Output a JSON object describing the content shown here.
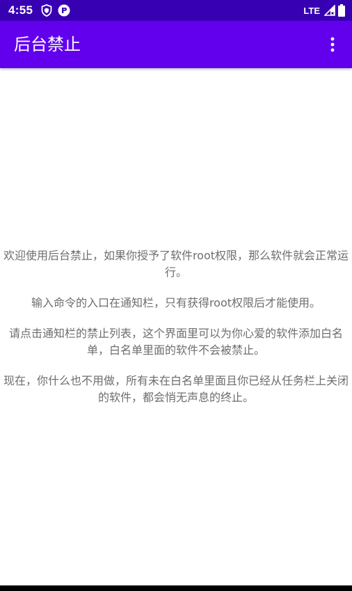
{
  "status_bar": {
    "time": "4:55",
    "network": "LTE",
    "icons_left": [
      "shield-icon",
      "app-notification-icon"
    ],
    "icons_right": [
      "signal-icon",
      "battery-icon"
    ]
  },
  "app_bar": {
    "title": "后台禁止",
    "menu_icon": "overflow-menu-icon"
  },
  "content": {
    "paragraphs": [
      "欢迎使用后台禁止，如果你授予了软件root权限，那么软件就会正常运行。",
      "输入命令的入口在通知栏，只有获得root权限后才能使用。",
      "请点击通知栏的禁止列表，这个界面里可以为你心爱的软件添加白名单，白名单里面的软件不会被禁止。",
      "现在，你什么也不用做，所有未在白名单里面且你已经从任务栏上关闭的软件，都会悄无声息的终止。"
    ]
  },
  "colors": {
    "status_bar": "#3700b3",
    "app_bar": "#6200ee",
    "text": "#6d6d6d",
    "background": "#ffffff"
  }
}
